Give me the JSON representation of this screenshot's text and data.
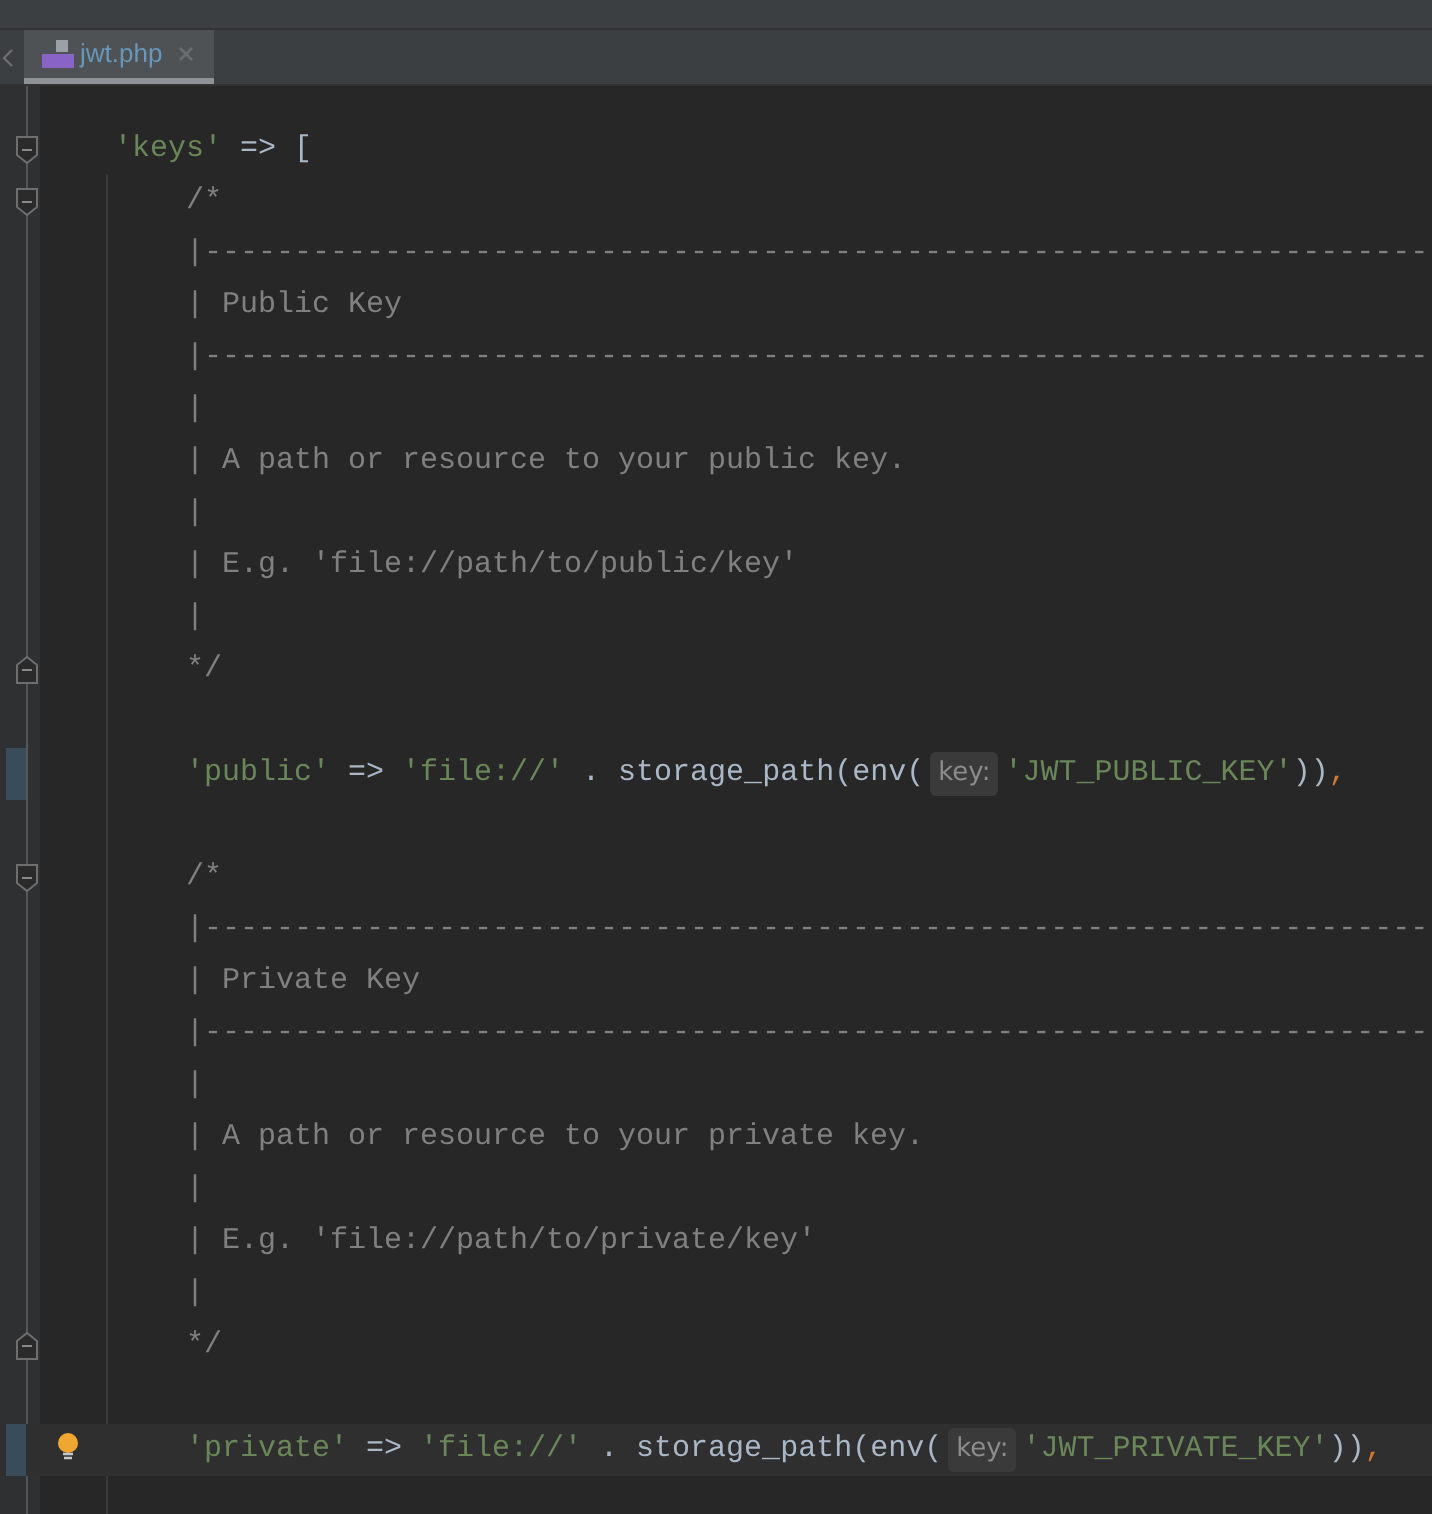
{
  "tab": {
    "label": "jwt.php",
    "selected": true
  },
  "lines": [
    {
      "fold_start": true,
      "fold_end": false,
      "changed": false,
      "current": false,
      "bulb": false,
      "tokens": [
        {
          "kind": "string",
          "text": "'keys'"
        },
        {
          "kind": "plain",
          "text": " => ["
        }
      ],
      "children": [
        {
          "fold_start": true,
          "fold_end": false,
          "changed": false,
          "current": false,
          "bulb": false,
          "tokens": [
            {
              "kind": "comment",
              "text": "/*"
            }
          ]
        },
        {
          "fold_start": false,
          "fold_end": false,
          "changed": false,
          "current": false,
          "bulb": false,
          "tokens": [
            {
              "kind": "comment",
              "text": "|--------------------------------------------------------------------"
            }
          ]
        },
        {
          "fold_start": false,
          "fold_end": false,
          "changed": false,
          "current": false,
          "bulb": false,
          "tokens": [
            {
              "kind": "comment",
              "text": "| Public Key"
            }
          ]
        },
        {
          "fold_start": false,
          "fold_end": false,
          "changed": false,
          "current": false,
          "bulb": false,
          "tokens": [
            {
              "kind": "comment",
              "text": "|--------------------------------------------------------------------"
            }
          ]
        },
        {
          "fold_start": false,
          "fold_end": false,
          "changed": false,
          "current": false,
          "bulb": false,
          "tokens": [
            {
              "kind": "comment",
              "text": "|"
            }
          ]
        },
        {
          "fold_start": false,
          "fold_end": false,
          "changed": false,
          "current": false,
          "bulb": false,
          "tokens": [
            {
              "kind": "comment",
              "text": "| A path or resource to your public key."
            }
          ]
        },
        {
          "fold_start": false,
          "fold_end": false,
          "changed": false,
          "current": false,
          "bulb": false,
          "tokens": [
            {
              "kind": "comment",
              "text": "|"
            }
          ]
        },
        {
          "fold_start": false,
          "fold_end": false,
          "changed": false,
          "current": false,
          "bulb": false,
          "tokens": [
            {
              "kind": "comment",
              "text": "| E.g. 'file://path/to/public/key'"
            }
          ]
        },
        {
          "fold_start": false,
          "fold_end": false,
          "changed": false,
          "current": false,
          "bulb": false,
          "tokens": [
            {
              "kind": "comment",
              "text": "|"
            }
          ]
        },
        {
          "fold_start": false,
          "fold_end": true,
          "changed": false,
          "current": false,
          "bulb": false,
          "tokens": [
            {
              "kind": "comment",
              "text": "*/"
            }
          ]
        },
        {
          "fold_start": false,
          "fold_end": false,
          "changed": false,
          "current": false,
          "bulb": false
        },
        {
          "fold_start": false,
          "fold_end": false,
          "changed": true,
          "current": false,
          "bulb": false,
          "tokens": [
            {
              "kind": "string",
              "text": "'public'"
            },
            {
              "kind": "plain",
              "text": " => "
            },
            {
              "kind": "string",
              "text": "'file://'"
            },
            {
              "kind": "plain",
              "text": " . storage_path(env("
            },
            {
              "kind": "hint",
              "text": "key:"
            },
            {
              "kind": "string",
              "text": "'JWT_PUBLIC_KEY'"
            },
            {
              "kind": "plain",
              "text": "))"
            },
            {
              "kind": "punct",
              "text": ","
            }
          ]
        },
        {
          "fold_start": false,
          "fold_end": false,
          "changed": false,
          "current": false,
          "bulb": false
        },
        {
          "fold_start": true,
          "fold_end": false,
          "changed": false,
          "current": false,
          "bulb": false,
          "tokens": [
            {
              "kind": "comment",
              "text": "/*"
            }
          ]
        },
        {
          "fold_start": false,
          "fold_end": false,
          "changed": false,
          "current": false,
          "bulb": false,
          "tokens": [
            {
              "kind": "comment",
              "text": "|--------------------------------------------------------------------"
            }
          ]
        },
        {
          "fold_start": false,
          "fold_end": false,
          "changed": false,
          "current": false,
          "bulb": false,
          "tokens": [
            {
              "kind": "comment",
              "text": "| Private Key"
            }
          ]
        },
        {
          "fold_start": false,
          "fold_end": false,
          "changed": false,
          "current": false,
          "bulb": false,
          "tokens": [
            {
              "kind": "comment",
              "text": "|--------------------------------------------------------------------"
            }
          ]
        },
        {
          "fold_start": false,
          "fold_end": false,
          "changed": false,
          "current": false,
          "bulb": false,
          "tokens": [
            {
              "kind": "comment",
              "text": "|"
            }
          ]
        },
        {
          "fold_start": false,
          "fold_end": false,
          "changed": false,
          "current": false,
          "bulb": false,
          "tokens": [
            {
              "kind": "comment",
              "text": "| A path or resource to your private key."
            }
          ]
        },
        {
          "fold_start": false,
          "fold_end": false,
          "changed": false,
          "current": false,
          "bulb": false,
          "tokens": [
            {
              "kind": "comment",
              "text": "|"
            }
          ]
        },
        {
          "fold_start": false,
          "fold_end": false,
          "changed": false,
          "current": false,
          "bulb": false,
          "tokens": [
            {
              "kind": "comment",
              "text": "| E.g. 'file://path/to/private/key'"
            }
          ]
        },
        {
          "fold_start": false,
          "fold_end": false,
          "changed": false,
          "current": false,
          "bulb": false,
          "tokens": [
            {
              "kind": "comment",
              "text": "|"
            }
          ]
        },
        {
          "fold_start": false,
          "fold_end": true,
          "changed": false,
          "current": false,
          "bulb": false,
          "tokens": [
            {
              "kind": "comment",
              "text": "*/"
            }
          ]
        },
        {
          "fold_start": false,
          "fold_end": false,
          "changed": false,
          "current": false,
          "bulb": false
        },
        {
          "fold_start": false,
          "fold_end": false,
          "changed": true,
          "current": true,
          "bulb": true,
          "tokens": [
            {
              "kind": "string",
              "text": "'private'"
            },
            {
              "kind": "plain",
              "text": " => "
            },
            {
              "kind": "string",
              "text": "'file://'"
            },
            {
              "kind": "plain",
              "text": " . storage_path(env("
            },
            {
              "kind": "hint",
              "text": "key:"
            },
            {
              "kind": "string",
              "text": "'JWT_PRIVATE_KEY'"
            },
            {
              "kind": "plain",
              "text": "))"
            },
            {
              "kind": "punct",
              "text": ","
            }
          ]
        }
      ]
    }
  ]
}
